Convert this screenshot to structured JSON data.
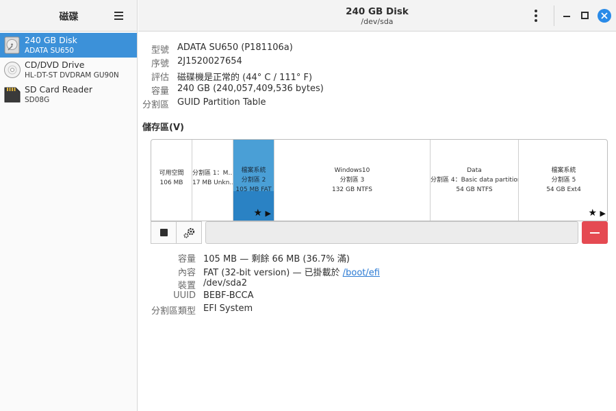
{
  "sidebar": {
    "title": "磁碟",
    "menu_icon": "hamburger-menu-icon",
    "disks": [
      {
        "name": "240 GB Disk",
        "model": "ADATA SU650",
        "icon": "drive-harddisk-icon"
      },
      {
        "name": "CD/DVD Drive",
        "model": "HL-DT-ST DVDRAM GU90N",
        "icon": "optical-drive-icon"
      },
      {
        "name": "SD Card Reader",
        "model": "SD08G",
        "icon": "sd-card-icon"
      }
    ],
    "selected_index": 0
  },
  "header": {
    "title": "240 GB Disk",
    "subtitle": "/dev/sda"
  },
  "disk_info": {
    "model_label": "型號",
    "model": "ADATA SU650 (P181106a)",
    "serial_label": "序號",
    "serial": "2J1520027654",
    "assessment_label": "評估",
    "assessment": "磁碟機是正常的 (44° C / 111° F)",
    "size_label": "容量",
    "size": "240 GB (240,057,409,536 bytes)",
    "partitioning_label": "分割區",
    "partitioning": "GUID Partition Table"
  },
  "volumes": {
    "title": "儲存區(V)",
    "segments": [
      {
        "lines": [
          "可用空間",
          "106 MB"
        ]
      },
      {
        "lines": [
          "分割區 1：M…",
          "17 MB Unkn…"
        ]
      },
      {
        "lines": [
          "檔案系統",
          "分割區 2",
          "105 MB FAT"
        ],
        "selected": true,
        "fill_percent": 36.7
      },
      {
        "lines": [
          "Windows10",
          "分割區 3",
          "132 GB NTFS"
        ]
      },
      {
        "lines": [
          "Data",
          "分割區 4：Basic data partition",
          "54 GB NTFS"
        ]
      },
      {
        "lines": [
          "檔案系統",
          "分割區 5",
          "54 GB Ext4"
        ]
      }
    ],
    "star_icon": "★",
    "mounted_icon": "▶"
  },
  "partition_info": {
    "size_label": "容量",
    "size": "105 MB — 剩餘 66 MB (36.7% 滿)",
    "contents_label": "內容",
    "contents_prefix": "FAT (32-bit version) — 已掛載於 ",
    "mount_point": "/boot/efi",
    "device_label": "裝置",
    "device": "/dev/sda2",
    "uuid_label": "UUID",
    "uuid": "BEBF-BCCA",
    "type_label": "分割區類型",
    "type": "EFI System"
  },
  "colors": {
    "accent": "#3c91d9",
    "selected_partition": "#4a9fd6",
    "selected_partition_used": "#2a82c4",
    "delete_button": "#e54a52",
    "close_button": "#2a8be8"
  }
}
